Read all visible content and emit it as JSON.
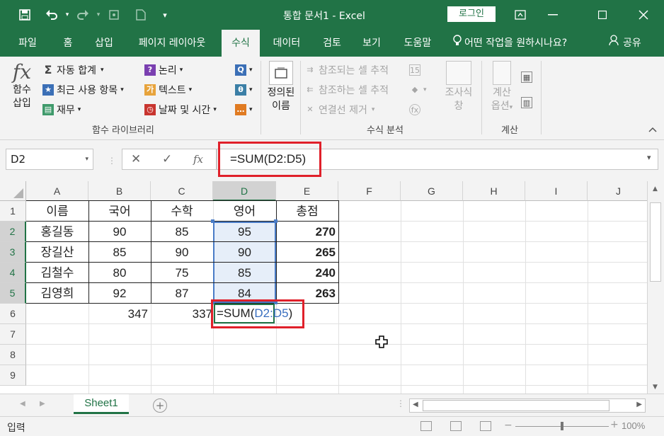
{
  "titlebar": {
    "doc_title": "통합 문서1 - Excel",
    "login": "로그인",
    "icons": [
      "save-icon",
      "undo-icon",
      "redo-icon",
      "touch-mode-icon",
      "new-icon",
      "customize-icon"
    ]
  },
  "tabs": [
    "파일",
    "홈",
    "삽입",
    "페이지 레이아웃",
    "수식",
    "데이터",
    "검토",
    "보기",
    "도움말"
  ],
  "active_tab": "수식",
  "tell_me": "어떤 작업을 원하시나요?",
  "share": "공유",
  "ribbon": {
    "insert_function": {
      "line1": "함수",
      "line2": "삽입"
    },
    "autosum": "자동 합계",
    "recent": "최근 사용 항목",
    "financial": "재무",
    "logical": "논리",
    "text": "텍스트",
    "datetime": "날짜 및 시간",
    "define_name": {
      "line1": "정의된",
      "line2": "이름"
    },
    "trace_precedents": "참조되는 셀 추적",
    "trace_dependents": "참조하는 셀 추적",
    "remove_arrows": "연결선 제거",
    "watch": {
      "line1": "조사식",
      "line2": "창"
    },
    "calc_options": {
      "line1": "계산",
      "line2": "옵션"
    },
    "group_function_library": "함수 라이브러리",
    "group_formula_auditing": "수식 분석",
    "group_calculation": "계산"
  },
  "name_box": "D2",
  "formula": "=SUM(D2:D5)",
  "columns": [
    "A",
    "B",
    "C",
    "D",
    "E",
    "F",
    "G",
    "H",
    "I",
    "J"
  ],
  "rows": [
    "1",
    "2",
    "3",
    "4",
    "5",
    "6",
    "7",
    "8",
    "9"
  ],
  "table": {
    "header": [
      "이름",
      "국어",
      "수학",
      "영어",
      "총점"
    ],
    "data": [
      [
        "홍길동",
        "90",
        "85",
        "95",
        "270"
      ],
      [
        "장길산",
        "85",
        "90",
        "90",
        "265"
      ],
      [
        "김철수",
        "80",
        "75",
        "85",
        "240"
      ],
      [
        "김영희",
        "92",
        "87",
        "84",
        "263"
      ]
    ],
    "row6": {
      "B": "347",
      "C": "337"
    }
  },
  "edit_cell": {
    "prefix": "=SUM(",
    "ref": "D2:D5",
    "suffix": ")"
  },
  "sheet_name": "Sheet1",
  "status": "입력",
  "zoom": "100%",
  "colors": {
    "excel_green": "#217346",
    "highlight_red": "#e0202a",
    "range_blue": "#4a7cc7"
  }
}
